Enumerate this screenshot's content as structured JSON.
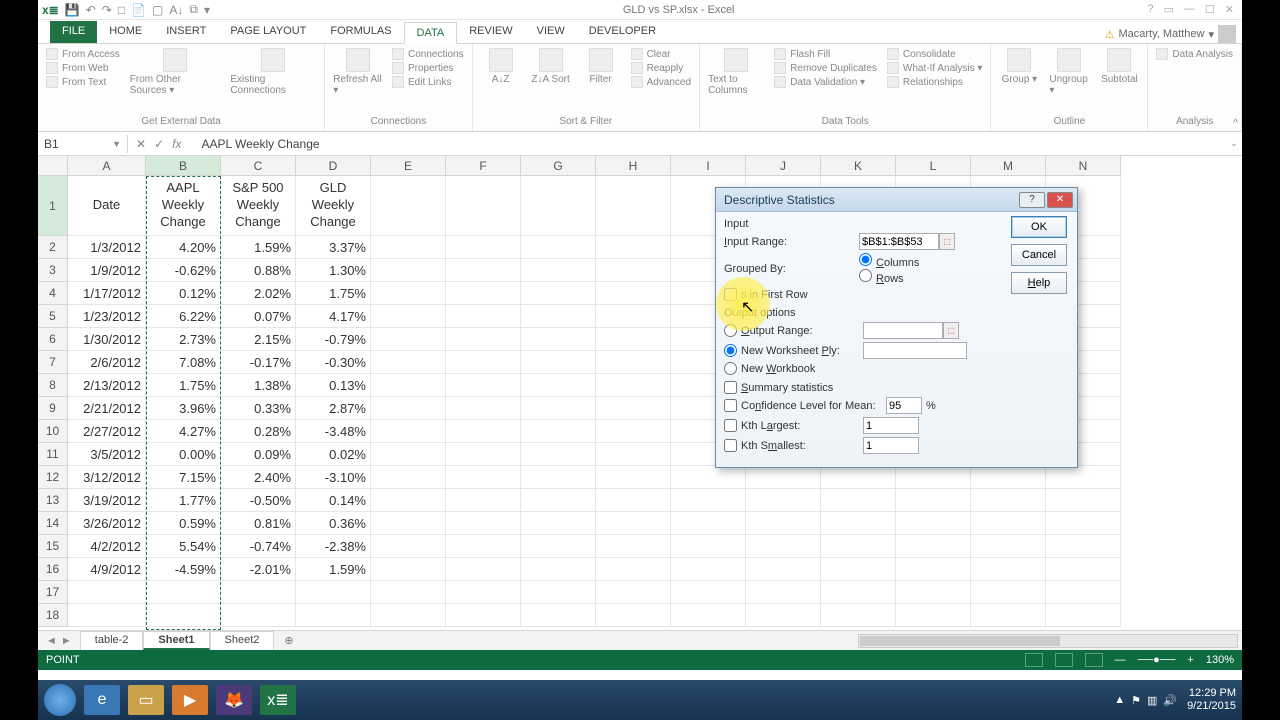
{
  "title": "GLD vs SP.xlsx - Excel",
  "user": "Macarty, Matthew",
  "tabs": [
    "FILE",
    "HOME",
    "INSERT",
    "PAGE LAYOUT",
    "FORMULAS",
    "DATA",
    "REVIEW",
    "VIEW",
    "DEVELOPER"
  ],
  "active_tab": "DATA",
  "ribbon": {
    "groups": [
      {
        "label": "Get External Data",
        "stack": [
          "From Access",
          "From Web",
          "From Text"
        ],
        "items": [
          {
            "t": "From Other Sources ▾"
          },
          {
            "t": "Existing Connections"
          }
        ]
      },
      {
        "label": "Connections",
        "items": [
          {
            "t": "Refresh All ▾"
          }
        ],
        "stack2": [
          "Connections",
          "Properties",
          "Edit Links"
        ]
      },
      {
        "label": "Sort & Filter",
        "items": [
          {
            "t": "A↓Z"
          },
          {
            "t": "Z↓A Sort"
          },
          {
            "t": "Filter"
          }
        ],
        "stack2": [
          "Clear",
          "Reapply",
          "Advanced"
        ]
      },
      {
        "label": "Data Tools",
        "items": [
          {
            "t": "Text to Columns"
          }
        ],
        "stack2": [
          "Flash Fill",
          "Remove Duplicates",
          "Data Validation ▾"
        ],
        "stack3": [
          "Consolidate",
          "What-If Analysis ▾",
          "Relationships"
        ]
      },
      {
        "label": "Outline",
        "items": [
          {
            "t": "Group ▾"
          },
          {
            "t": "Ungroup ▾"
          },
          {
            "t": "Subtotal"
          }
        ]
      },
      {
        "label": "Analysis",
        "stack": [
          "Data Analysis"
        ]
      }
    ]
  },
  "namebox": "B1",
  "formula": "AAPL Weekly Change",
  "columns": [
    "A",
    "B",
    "C",
    "D",
    "E",
    "F",
    "G",
    "H",
    "I",
    "J",
    "K",
    "L",
    "M",
    "N"
  ],
  "headers": {
    "A": "Date",
    "B": "AAPL Weekly Change",
    "C": "S&P 500 Weekly Change",
    "D": "GLD Weekly Change"
  },
  "rows": [
    {
      "n": 2,
      "A": "1/3/2012",
      "B": "4.20%",
      "C": "1.59%",
      "D": "3.37%"
    },
    {
      "n": 3,
      "A": "1/9/2012",
      "B": "-0.62%",
      "C": "0.88%",
      "D": "1.30%"
    },
    {
      "n": 4,
      "A": "1/17/2012",
      "B": "0.12%",
      "C": "2.02%",
      "D": "1.75%"
    },
    {
      "n": 5,
      "A": "1/23/2012",
      "B": "6.22%",
      "C": "0.07%",
      "D": "4.17%"
    },
    {
      "n": 6,
      "A": "1/30/2012",
      "B": "2.73%",
      "C": "2.15%",
      "D": "-0.79%"
    },
    {
      "n": 7,
      "A": "2/6/2012",
      "B": "7.08%",
      "C": "-0.17%",
      "D": "-0.30%"
    },
    {
      "n": 8,
      "A": "2/13/2012",
      "B": "1.75%",
      "C": "1.38%",
      "D": "0.13%"
    },
    {
      "n": 9,
      "A": "2/21/2012",
      "B": "3.96%",
      "C": "0.33%",
      "D": "2.87%"
    },
    {
      "n": 10,
      "A": "2/27/2012",
      "B": "4.27%",
      "C": "0.28%",
      "D": "-3.48%"
    },
    {
      "n": 11,
      "A": "3/5/2012",
      "B": "0.00%",
      "C": "0.09%",
      "D": "0.02%"
    },
    {
      "n": 12,
      "A": "3/12/2012",
      "B": "7.15%",
      "C": "2.40%",
      "D": "-3.10%"
    },
    {
      "n": 13,
      "A": "3/19/2012",
      "B": "1.77%",
      "C": "-0.50%",
      "D": "0.14%"
    },
    {
      "n": 14,
      "A": "3/26/2012",
      "B": "0.59%",
      "C": "0.81%",
      "D": "0.36%"
    },
    {
      "n": 15,
      "A": "4/2/2012",
      "B": "5.54%",
      "C": "-0.74%",
      "D": "-2.38%"
    },
    {
      "n": 16,
      "A": "4/9/2012",
      "B": "-4.59%",
      "C": "-2.01%",
      "D": "1.59%"
    }
  ],
  "sheets": [
    "table-2",
    "Sheet1",
    "Sheet2"
  ],
  "active_sheet": "Sheet1",
  "add_sheet": "⊕",
  "status_mode": "POINT",
  "zoom": "130%",
  "dialog": {
    "title": "Descriptive Statistics",
    "input_section": "Input",
    "input_range_label": "Input Range:",
    "input_range": "$B$1:$B$53",
    "grouped_label": "Grouped By:",
    "grouped_columns": "Columns",
    "grouped_rows": "Rows",
    "labels_first_row": "s in First Row",
    "output_section": "Output options",
    "output_range_label": "Output Range:",
    "new_ws_label": "New Worksheet Ply:",
    "new_wb_label": "New Workbook",
    "summary_label": "Summary statistics",
    "confidence_label": "Confidence Level for Mean:",
    "confidence_val": "95",
    "pct": "%",
    "kth_largest": "Kth Largest:",
    "kth_largest_val": "1",
    "kth_smallest": "Kth Smallest:",
    "kth_smallest_val": "1",
    "ok": "OK",
    "cancel": "Cancel",
    "help": "Help"
  },
  "taskbar": {
    "time": "12:29 PM",
    "date": "9/21/2015"
  }
}
